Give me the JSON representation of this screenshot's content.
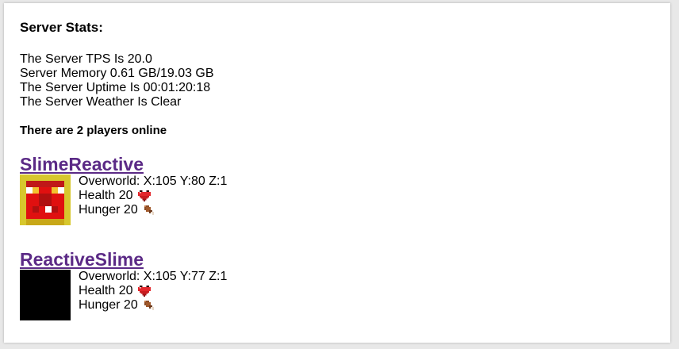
{
  "header": {
    "title": "Server Stats:"
  },
  "stats": {
    "tps": "The Server TPS Is 20.0",
    "memory": "Server Memory 0.61 GB/19.03 GB",
    "uptime": "The Server Uptime Is 00:01:20:18",
    "weather": "The Server Weather Is Clear"
  },
  "online_text": "There are 2 players online",
  "players": [
    {
      "name": "SlimeReactive",
      "location": "Overworld: X:105 Y:80 Z:1",
      "health": "Health 20",
      "hunger": "Hunger 20",
      "avatar": "red-creeper-face"
    },
    {
      "name": "ReactiveSlime",
      "location": "Overworld: X:105 Y:77 Z:1",
      "health": "Health 20",
      "hunger": "Hunger 20",
      "avatar": "black-square"
    }
  ],
  "icons": {
    "health": "heart-icon",
    "hunger": "drumstick-icon"
  },
  "colors": {
    "link": "#5b2a86",
    "heart": "#e3262b",
    "avatar_frame": "#d7c72d"
  }
}
